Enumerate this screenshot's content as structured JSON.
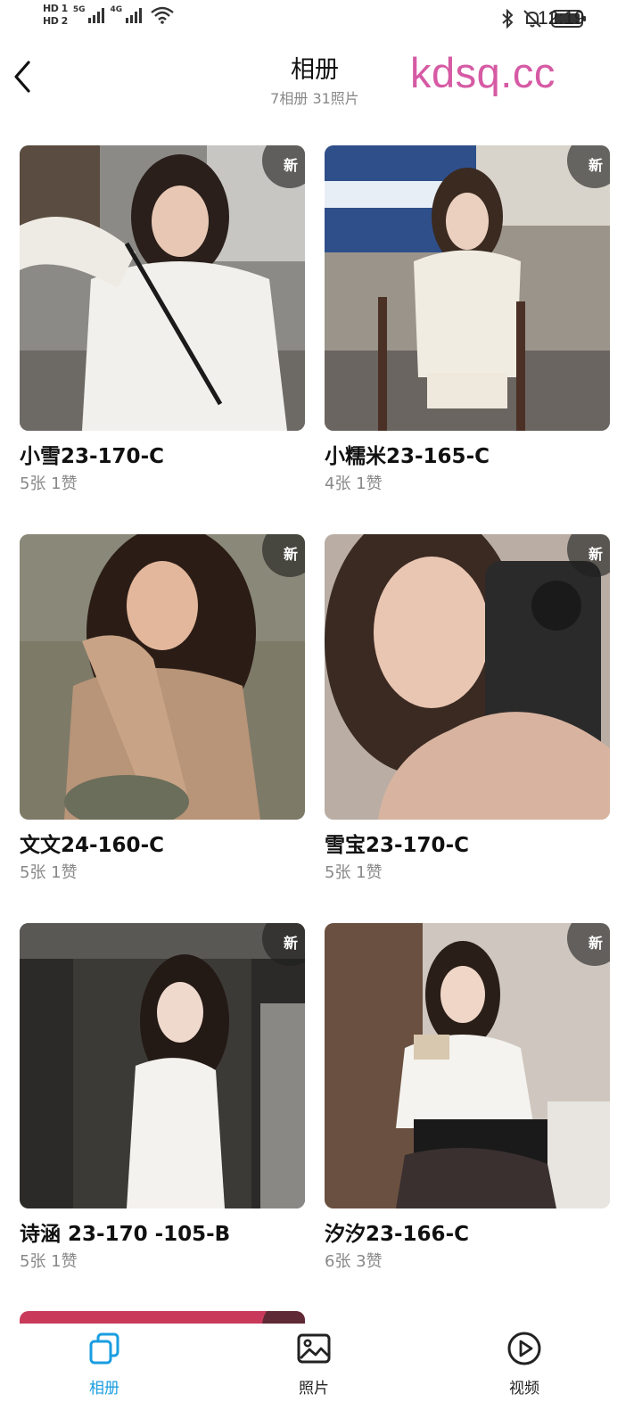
{
  "status_bar": {
    "sim1": "HD 1",
    "sim2": "HD 2",
    "net1": "5G",
    "net2": "4G",
    "time": "12:19"
  },
  "header": {
    "title": "相册",
    "subtitle": "7相册  31照片",
    "back_icon": "chevron-left-icon"
  },
  "watermark": "kdsq.cc",
  "badge_label": "新",
  "albums": [
    {
      "name": "小雪23-170-C",
      "meta": "5张  1赞",
      "is_new": true
    },
    {
      "name": "小糯米23-165-C",
      "meta": "4张  1赞",
      "is_new": true
    },
    {
      "name": "文文24-160-C",
      "meta": "5张  1赞",
      "is_new": true
    },
    {
      "name": "雪宝23-170-C",
      "meta": "5张  1赞",
      "is_new": true
    },
    {
      "name": "诗涵 23-170 -105-B",
      "meta": "5张  1赞",
      "is_new": true
    },
    {
      "name": "汐汐23-166-C",
      "meta": "6张  3赞",
      "is_new": true
    }
  ],
  "bottom_nav": {
    "items": [
      {
        "label": "相册",
        "icon": "albums-icon",
        "active": true
      },
      {
        "label": "照片",
        "icon": "image-icon",
        "active": false
      },
      {
        "label": "视频",
        "icon": "play-circle-icon",
        "active": false
      }
    ]
  },
  "colors": {
    "accent": "#1a9ee0",
    "watermark": "#d65aa4",
    "meta_text": "#888888"
  }
}
